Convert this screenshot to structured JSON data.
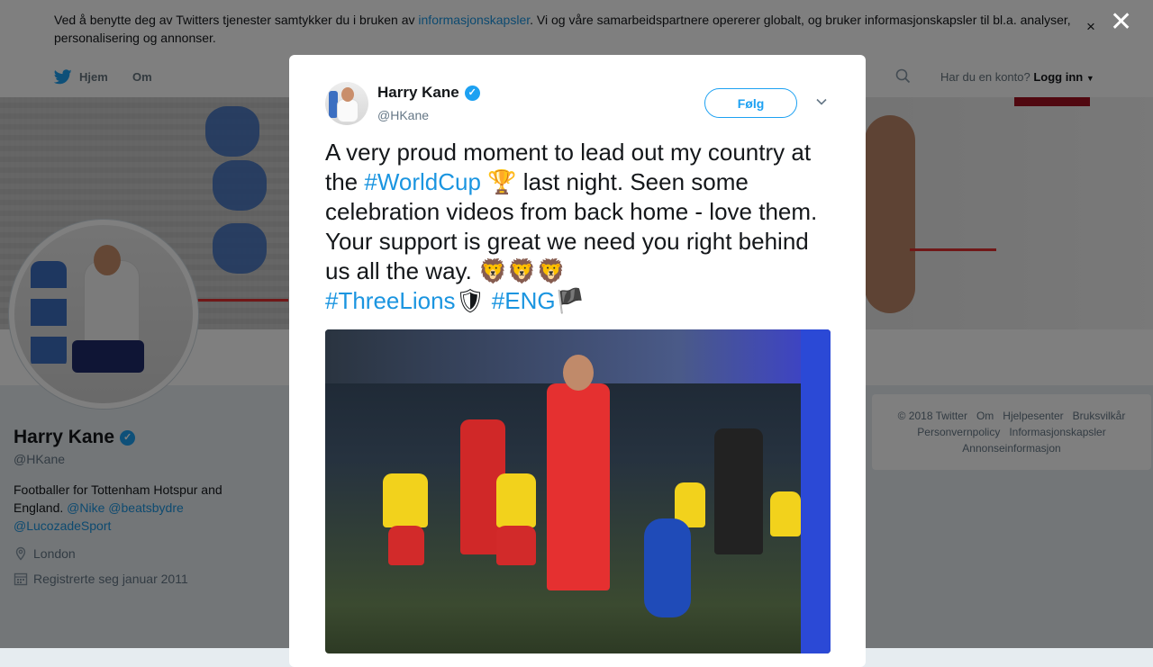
{
  "cookie_banner": {
    "text_before": "Ved å benytte deg av Twitters tjenester samtykker du i bruken av ",
    "link": "informasjonskapsler",
    "text_after": ". Vi og våre samarbeidspartnere opererer globalt, og bruker informasjonskapsler til bl.a. analyser, personalisering og annonser.",
    "close": "×"
  },
  "nav": {
    "home": "Hjem",
    "about": "Om",
    "account_prompt": "Har du en konto?",
    "login": "Logg inn"
  },
  "profile": {
    "name": "Harry Kane",
    "handle": "@HKane",
    "bio_text": "Footballer for Tottenham Hotspur and England.",
    "bio_links": [
      "@Nike",
      "@beatsbydre",
      "@LucozadeSport"
    ],
    "location": "London",
    "joined": "Registrerte seg januar 2011"
  },
  "footer": {
    "row1": [
      "© 2018 Twitter",
      "Om",
      "Hjelpesenter",
      "Bruksvilkår"
    ],
    "row2": [
      "Personvernpolicy",
      "Informasjonskapsler"
    ],
    "row3": [
      "Annonseinformasjon"
    ]
  },
  "modal": {
    "close": "✕",
    "name": "Harry Kane",
    "handle": "@HKane",
    "follow_label": "Følg",
    "tweet": {
      "part1": "A very proud moment to lead out my country at the ",
      "hashtag_worldcup": "#WorldCup",
      "emoji_cup": "🏆",
      "part2": " last night. Seen some celebration videos from back home - love them. Your support is great we need you right behind us all the way. ",
      "emoji_lions": "🦁🦁🦁",
      "hashtag_threelions": "#ThreeLions",
      "emoji_shield": "🛡",
      "hashtag_eng": "#ENG",
      "emoji_flag": "🏴"
    }
  },
  "colors": {
    "link": "#1b95e0",
    "verified": "#1da1f2",
    "overlay": "rgba(0,0,0,0.5)"
  }
}
